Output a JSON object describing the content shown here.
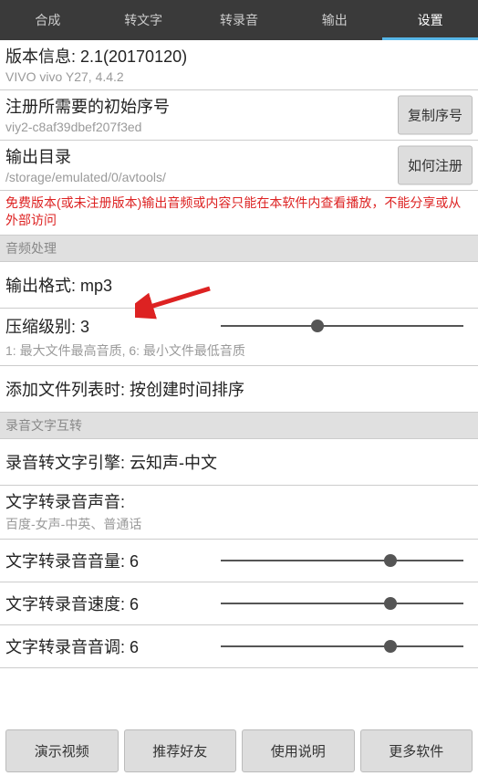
{
  "tabs": {
    "t0": "合成",
    "t1": "转文字",
    "t2": "转录音",
    "t3": "输出",
    "t4": "设置"
  },
  "version": {
    "label": "版本信息: 2.1(20170120)",
    "sub": "VIVO vivo Y27, 4.4.2"
  },
  "serial": {
    "label": "注册所需要的初始序号",
    "value": "viy2-c8af39dbef207f3ed",
    "copy_btn": "复制序号"
  },
  "outdir": {
    "label": "输出目录",
    "path": "/storage/emulated/0/avtools/",
    "reg_btn": "如何注册"
  },
  "red_note": "免费版本(或未注册版本)输出音频或内容只能在本软件内查看播放，不能分享或从外部访问",
  "audio_group": "音频处理",
  "out_format": "输出格式: mp3",
  "compress": {
    "label": "压缩级别: 3",
    "sub": "1: 最大文件最高音质, 6: 最小文件最低音质",
    "pos": 40
  },
  "add_list": "添加文件列表时: 按创建时间排序",
  "stt_group": "录音文字互转",
  "stt_engine": "录音转文字引擎: 云知声-中文",
  "tts_voice": {
    "label": "文字转录音声音:",
    "sub": "百度-女声-中英、普通话"
  },
  "tts_volume": {
    "label": "文字转录音音量: 6",
    "pos": 70
  },
  "tts_speed": {
    "label": "文字转录音速度: 6",
    "pos": 70
  },
  "tts_pitch": {
    "label": "文字转录音音调: 6",
    "pos": 70
  },
  "bottom": {
    "b0": "演示视频",
    "b1": "推荐好友",
    "b2": "使用说明",
    "b3": "更多软件"
  }
}
